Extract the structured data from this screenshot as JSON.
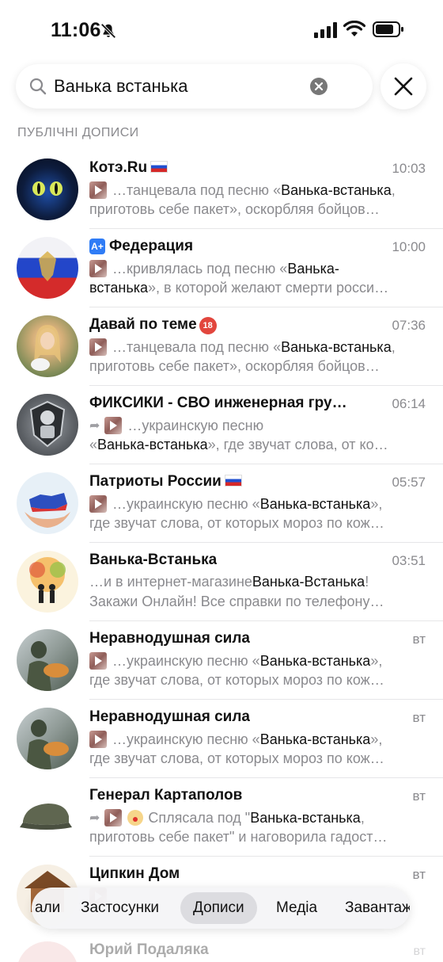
{
  "status": {
    "time": "11:06"
  },
  "search": {
    "query": "Ванька встанька"
  },
  "section_title": "ПУБЛІЧНІ ДОПИСИ",
  "results": [
    {
      "title": "Котэ.Ru",
      "time": "10:03",
      "line1_pre": "…танцевала под песню «",
      "line1_hl": "Ванька-встанька",
      "line1_post": ",",
      "line2": "приготовь себе пакет», оскорбляя бойцов…"
    },
    {
      "title": "Федерация",
      "time": "10:00",
      "line1_pre": "…кривлялась под песню «",
      "line1_hl": "Ванька-",
      "line1_post": "",
      "line2_hl": "встанька",
      "line2": "», в которой желают смерти росси…"
    },
    {
      "title": "Давай по теме",
      "badge": "18",
      "time": "07:36",
      "line1_pre": "…танцевала под песню «",
      "line1_hl": "Ванька-встанька",
      "line1_post": ",",
      "line2": "приготовь себе пакет», оскорбляя бойцов…"
    },
    {
      "title": "ФИКСИКИ - СВО инженерная гру…",
      "time": "06:14",
      "line1_pre": "…украинскую песню",
      "line1_hl": "",
      "line1_post": "",
      "line2_pre": "«",
      "line2_hl": "Ванька-встанька",
      "line2": "», где звучат слова, от ко…"
    },
    {
      "title": "Патриоты России",
      "time": "05:57",
      "line1_pre": "…украинскую песню «",
      "line1_hl": "Ванька-встанька",
      "line1_post": "»,",
      "line2": "где звучат слова, от которых мороз по кож…"
    },
    {
      "title": "Ванька-Встанька",
      "time": "03:51",
      "line1_pre": "…и в интернет-магазине ",
      "line1_hl": "Ванька-Встанька",
      "line1_post": "!",
      "line2": "Закажи Онлайн! Все справки по телефону…"
    },
    {
      "title": "Неравнодушная сила",
      "time": "вт",
      "line1_pre": "…украинскую песню «",
      "line1_hl": "Ванька-встанька",
      "line1_post": "»,",
      "line2": "где звучат слова, от которых мороз по кож…"
    },
    {
      "title": "Неравнодушная сила",
      "time": "вт",
      "line1_pre": "…украинскую песню «",
      "line1_hl": "Ванька-встанька",
      "line1_post": "»,",
      "line2": "где звучат слова, от которых мороз по кож…"
    },
    {
      "title": "Генерал Картаполов",
      "time": "вт",
      "line1_pre": "Сплясала под \"",
      "line1_hl": "Ванька-встанька",
      "line1_post": ",",
      "line2": "приготовь себе пакет\" и наговорила гадост…"
    },
    {
      "title": "Ципкин Дом",
      "time": "вт"
    }
  ],
  "faded_row": {
    "title": "Юрий Подаляка",
    "time": "вт"
  },
  "tabs": [
    "али",
    "Застосунки",
    "Дописи",
    "Медіа",
    "Завантаж"
  ],
  "active_tab": "Дописи",
  "colors": {
    "accent_blue": "#2f7cf6",
    "secondary_text": "#8a8a8e",
    "highlight_text": "#111111"
  }
}
